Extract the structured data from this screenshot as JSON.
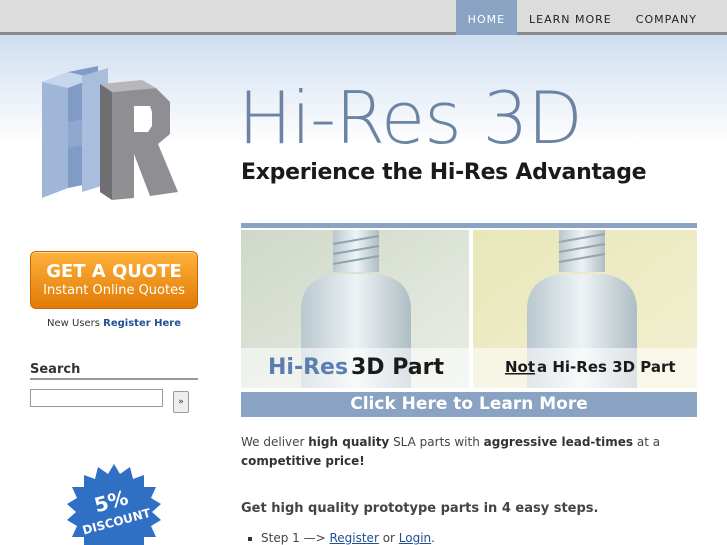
{
  "nav": {
    "items": [
      {
        "label": "HOME",
        "active": true
      },
      {
        "label": "LEARN MORE",
        "active": false
      },
      {
        "label": "COMPANY",
        "active": false
      }
    ]
  },
  "logo": {
    "icon": "hr-logo-icon",
    "letters": "HR"
  },
  "brand": {
    "title": "Hi-Res 3D",
    "tagline": "Experience the Hi-Res Advantage"
  },
  "sidebar": {
    "quote_button": {
      "line1": "GET A QUOTE",
      "line2": "Instant Online Quotes"
    },
    "new_users_prefix": "New Users",
    "register_link": "Register Here",
    "search": {
      "heading": "Search",
      "value": "",
      "go_label": "»"
    },
    "discount_badge": {
      "percent": "5%",
      "label": "DISCOUNT"
    }
  },
  "promo": {
    "left_caption_part1": "Hi-Res",
    "left_caption_part2": "3D Part",
    "right_caption_not": "Not",
    "right_caption_rest": "a Hi-Res 3D Part",
    "cta": "Click Here to Learn More"
  },
  "intro": {
    "t1": "We deliver ",
    "b1": "high quality",
    "t2": " SLA parts with ",
    "b2": "aggressive lead-times",
    "t3": " at a ",
    "b3": "competitive price!"
  },
  "steps": {
    "heading": "Get high quality prototype parts in 4 easy steps.",
    "step1_prefix": "Step 1 —> ",
    "step1_register": "Register",
    "step1_or": " or ",
    "step1_login": "Login",
    "step1_suffix": "."
  },
  "colors": {
    "accent": "#8aa3c3",
    "brand_text": "#6c84a4",
    "quote_orange": "#f0961e",
    "link": "#1f4f94",
    "badge_blue": "#2f6fc4"
  }
}
